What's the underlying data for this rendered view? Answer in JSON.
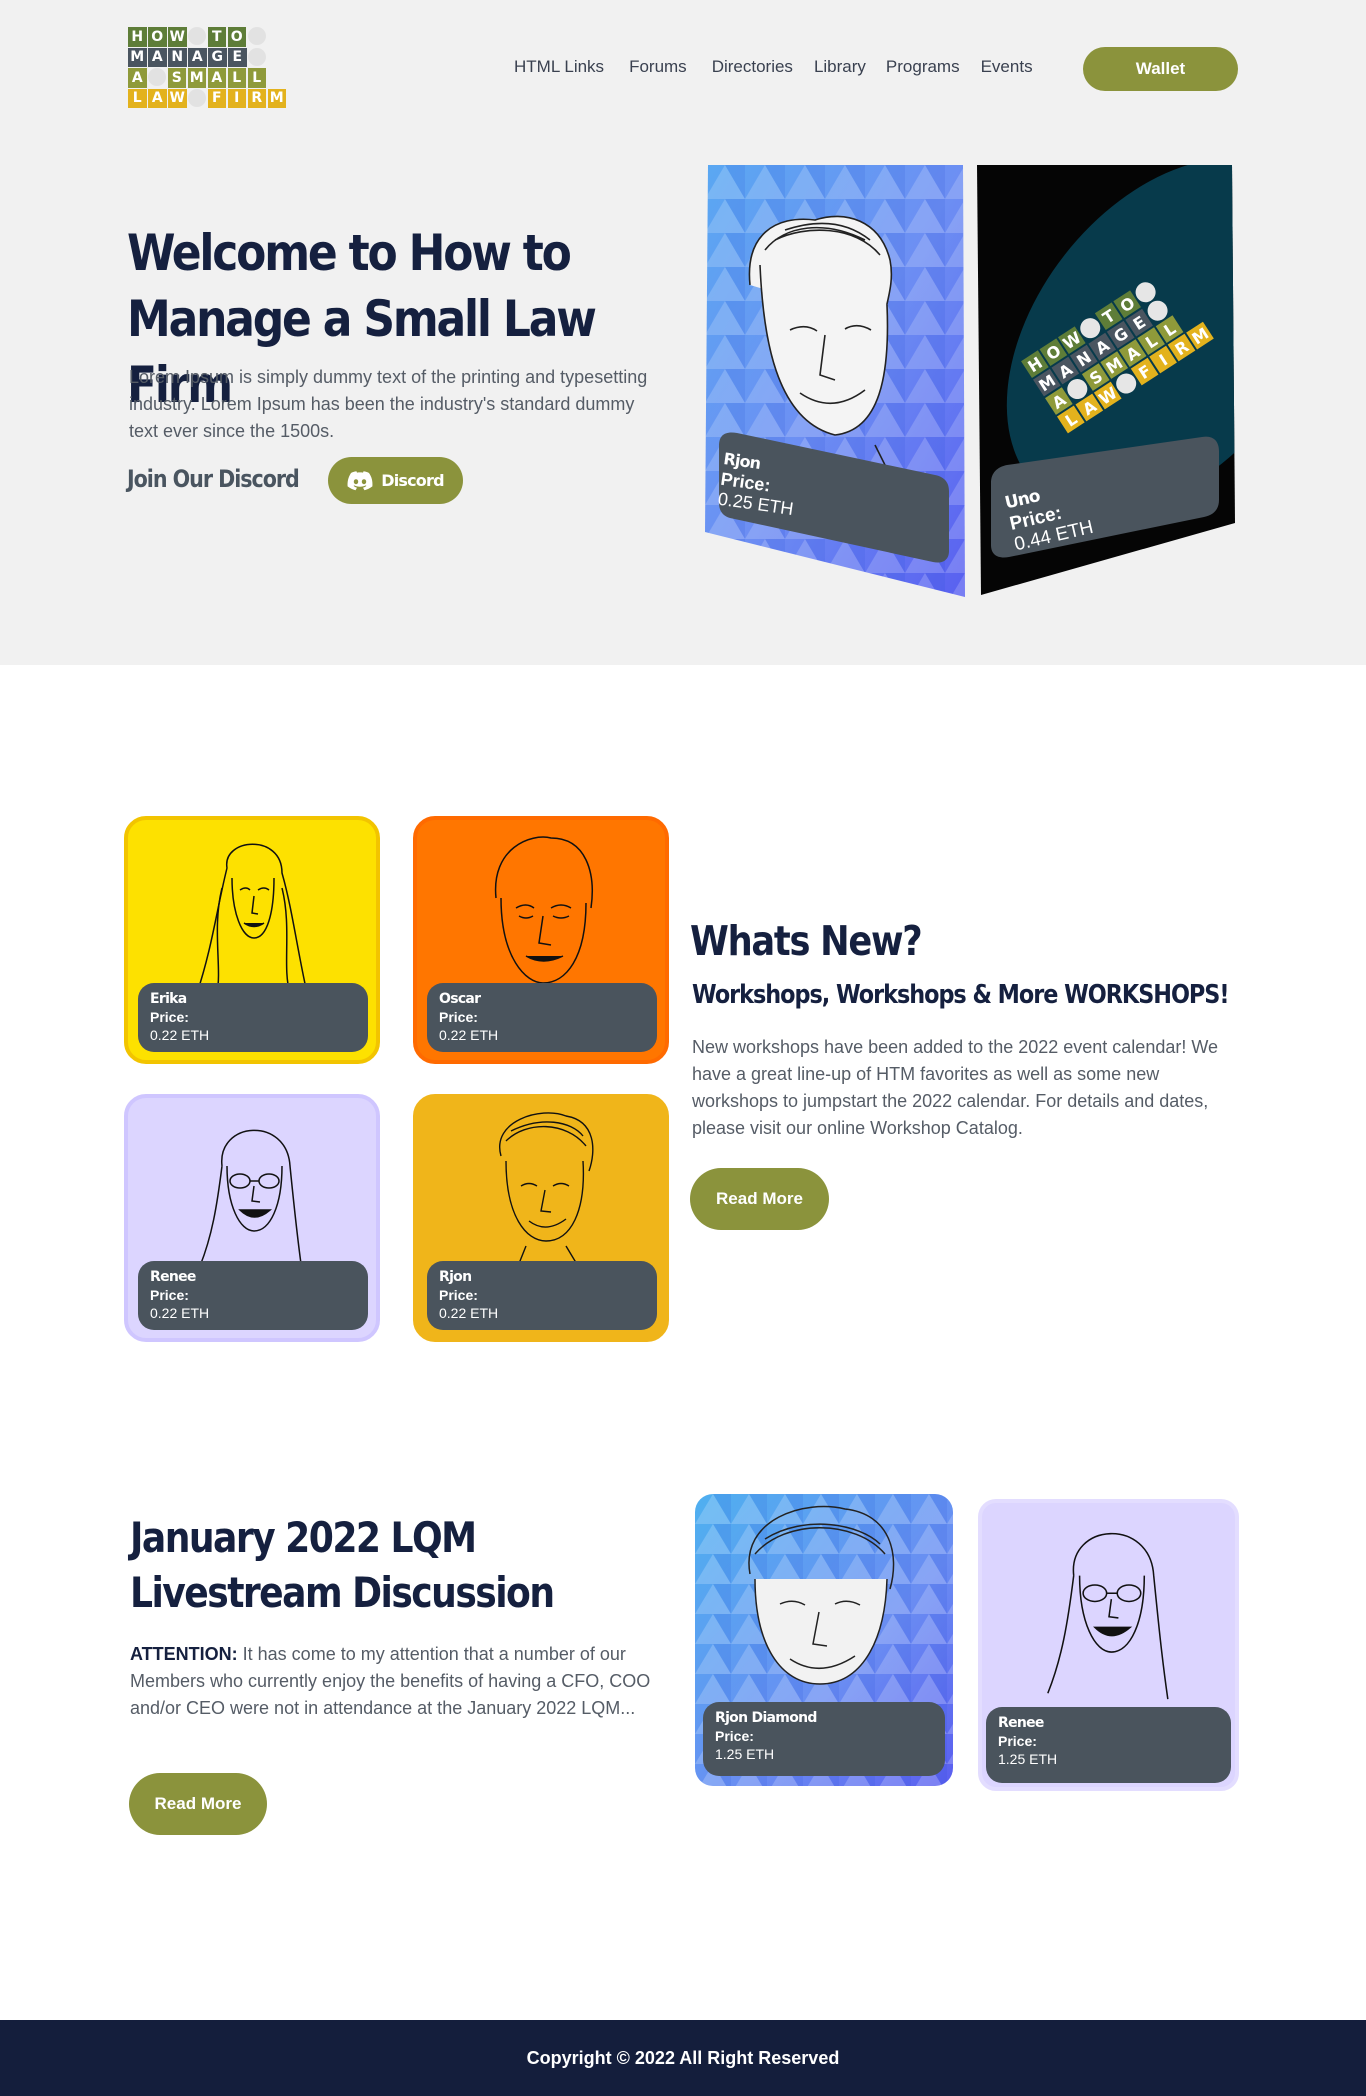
{
  "logo": {
    "rows": [
      [
        "H",
        "O",
        "W",
        "",
        "T",
        "O"
      ],
      [
        "M",
        "A",
        "N",
        "A",
        "G",
        "E"
      ],
      [
        "A",
        "",
        "S",
        "M",
        "A",
        "L",
        "L"
      ],
      [
        "L",
        "A",
        "W",
        "",
        "F",
        "I",
        "R",
        "M"
      ]
    ]
  },
  "nav": {
    "items": [
      "HTML Links",
      "Forums",
      "Directories",
      "Library",
      "Programs",
      "Events"
    ],
    "wallet_label": "Wallet"
  },
  "hero": {
    "title": "Welcome to How to Manage a Small Law Firm",
    "text": "Lorem Ipsum is simply dummy text of the printing and typesetting industry. Lorem Ipsum has been the industry's standard dummy text ever since the 1500s.",
    "discord_label": "Join Our Discord",
    "discord_button": "Discord",
    "cards": [
      {
        "name": "Rjon",
        "price_label": "Price:",
        "price": "0.25 ETH"
      },
      {
        "name": "Uno",
        "price_label": "Price:",
        "price": "0.44 ETH"
      }
    ]
  },
  "whats_new": {
    "title": "Whats New?",
    "subtitle": "Workshops, Workshops & More WORKSHOPS!",
    "text": "New workshops have been added to the 2022 event calendar! We have a great line-up of HTM favorites as well as some new workshops to jumpstart the 2022 calendar. For details and dates, please visit our online Workshop Catalog.",
    "button": "Read More",
    "cards": [
      {
        "name": "Erika",
        "price_label": "Price:",
        "price": "0.22 ETH",
        "color": "#fde100",
        "border": "#f2c400"
      },
      {
        "name": "Oscar",
        "price_label": "Price:",
        "price": "0.22 ETH",
        "color": "#ff7600",
        "border": "#ff6a00"
      },
      {
        "name": "Renee",
        "price_label": "Price:",
        "price": "0.22 ETH",
        "color": "#dcd5ff",
        "border": "#cfc6ff"
      },
      {
        "name": "Rjon",
        "price_label": "Price:",
        "price": "0.22 ETH",
        "color": "#f0b51a",
        "border": "#f0b51a"
      }
    ]
  },
  "livestream": {
    "title_line1": "January 2022 LQM",
    "title_line2": "Livestream Discussion",
    "attention_label": "ATTENTION:",
    "text": " It has come to my attention that a number of our Members who currently enjoy the benefits of having a CFO, COO and/or CEO were not in attendance at the January 2022 LQM...",
    "button": "Read More",
    "cards": [
      {
        "name": "Rjon Diamond",
        "price_label": "Price:",
        "price": "1.25 ETH"
      },
      {
        "name": "Renee",
        "price_label": "Price:",
        "price": "1.25 ETH"
      }
    ]
  },
  "footer": {
    "text": "Copyright © 2022 All Right Reserved"
  },
  "colors": {
    "accent": "#8b933c",
    "navy": "#15203f",
    "footer": "#141e3c",
    "card_info": "#4a545d"
  }
}
